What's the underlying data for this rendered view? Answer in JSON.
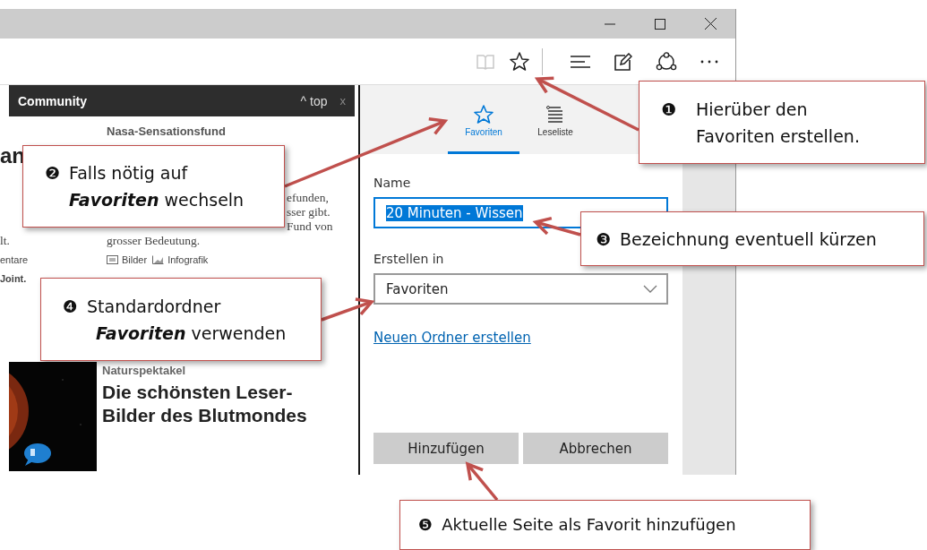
{
  "toolbar": {
    "buttons": [
      {
        "kind": "reading",
        "disabled": true
      },
      {
        "kind": "favorite",
        "disabled": false
      },
      {
        "kind": "hub",
        "disabled": false
      },
      {
        "kind": "note",
        "disabled": false
      },
      {
        "kind": "share",
        "disabled": false
      },
      {
        "kind": "more",
        "disabled": false
      }
    ]
  },
  "webpage": {
    "community_bar": {
      "title": "Community",
      "top_link": "^ top",
      "close": "x"
    },
    "article_1": {
      "kicker": "Nasa-Sensationsfund",
      "heading_fragment": "an",
      "text_fragments": [
        "efunden,",
        "sser gibt.",
        "Fund von"
      ],
      "text_end": "grosser Bedeutung.",
      "left_fragments": [
        "lt.",
        "entare",
        "Joint."
      ],
      "media": [
        {
          "kind": "gallery",
          "label": "Bilder"
        },
        {
          "kind": "chart",
          "label": "Infografik"
        }
      ]
    },
    "article_2": {
      "kicker": "Naturspektakel",
      "title": "Die schönsten Leser-Bilder des Blutmondes"
    }
  },
  "panel": {
    "tabs": [
      {
        "label": "Favoriten",
        "kind": "star",
        "selected": true
      },
      {
        "label": "Leseliste",
        "kind": "list",
        "selected": false
      }
    ],
    "name_label": "Name",
    "name_value": "20 Minuten - Wissen",
    "name_value_selected": true,
    "folder_label": "Erstellen in",
    "folder_value": "Favoriten",
    "new_folder_link": "Neuen Ordner erstellen",
    "buttons": [
      "Hinzufügen",
      "Abbrechen"
    ]
  },
  "callouts": [
    {
      "number": "❶",
      "lines": [
        "Hierüber den",
        "Favoriten erstellen."
      ]
    },
    {
      "number": "❷",
      "lines": [
        "Falls nötig auf",
        "**Favoriten** wechseln"
      ]
    },
    {
      "number": "❸",
      "lines": [
        "Bezeichnung eventuell kürzen"
      ]
    },
    {
      "number": "❹",
      "lines": [
        "Standardordner",
        "**Favoriten** verwenden"
      ]
    },
    {
      "number": "❺",
      "lines": [
        "Aktuelle Seite als Favorit hinzufügen"
      ]
    }
  ]
}
